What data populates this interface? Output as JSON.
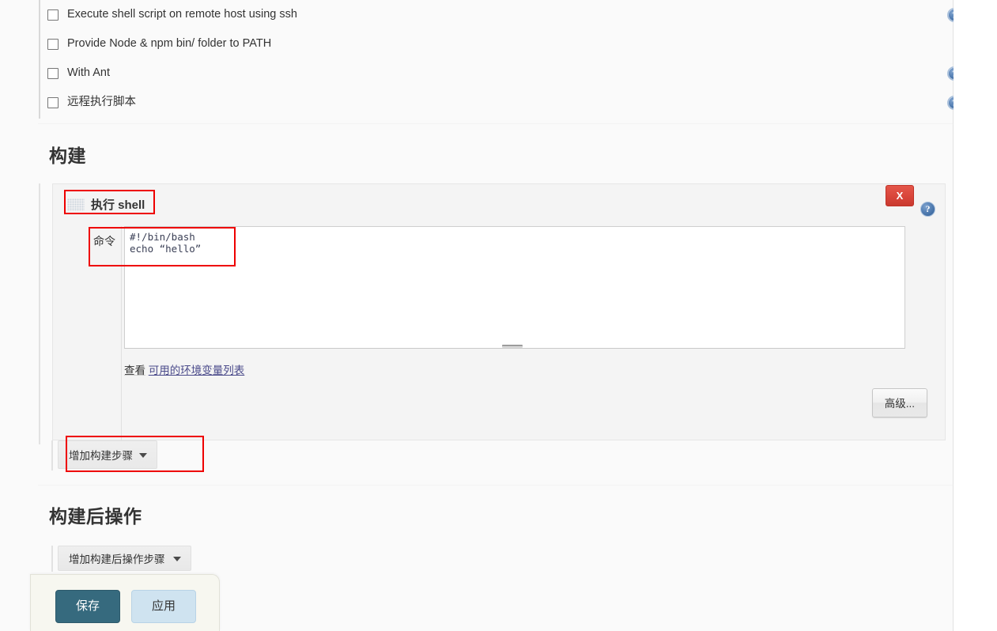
{
  "checkbox_options": [
    {
      "label": "Execute shell script on remote host using ssh",
      "checked": false,
      "help": true
    },
    {
      "label": "Provide Node & npm bin/ folder to PATH",
      "checked": false,
      "help": false
    },
    {
      "label": "With Ant",
      "checked": false,
      "help": true
    },
    {
      "label": "远程执行脚本",
      "checked": false,
      "help": true
    }
  ],
  "build_section": {
    "heading": "构建",
    "step": {
      "title": "执行 shell",
      "delete_label": "X",
      "command_label": "命令",
      "command_value": "#!/bin/bash\necho “hello”",
      "see_prefix": "查看",
      "see_link": "可用的环境变量列表",
      "advanced_label": "高级..."
    },
    "add_step_label": "增加构建步骤"
  },
  "post_build_section": {
    "heading": "构建后操作",
    "add_step_label": "增加构建后操作步骤"
  },
  "footer": {
    "save_label": "保存",
    "apply_label": "应用"
  },
  "icons": {
    "help": "help-icon",
    "grip": "drag-handle-icon",
    "chevron": "chevron-down-icon",
    "close": "close-icon"
  },
  "colors": {
    "annotation": "#ee0000",
    "save_button": "#366a7e",
    "apply_button": "#cfe3f0",
    "delete_button": "#d9453a",
    "help_icon": "#2f5d96"
  }
}
